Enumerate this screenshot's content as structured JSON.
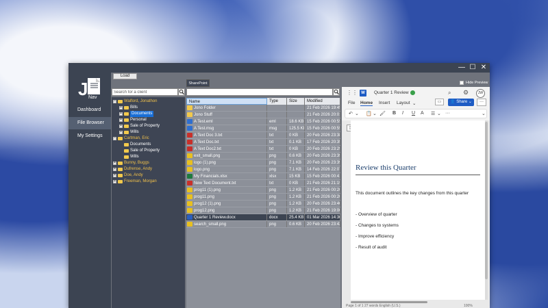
{
  "app": {
    "logo_letters": "JNav",
    "window_controls": [
      "—",
      "☐",
      "✕"
    ],
    "nav": [
      {
        "label": "Dashboard",
        "active": false
      },
      {
        "label": "File Browser",
        "active": true
      },
      {
        "label": "My Settings",
        "active": false
      }
    ],
    "load_label": "Load",
    "sharepoint_tab": "SharePoint",
    "hide_preview_label": "Hide Preview"
  },
  "clients": {
    "search_placeholder": "Search for a client",
    "tree": [
      {
        "label": "Walford, Jonathon",
        "level": 0,
        "exp": "−"
      },
      {
        "label": "Bills",
        "level": 1,
        "exp": "+"
      },
      {
        "label": "Documents",
        "level": 1,
        "exp": "+",
        "selected": true
      },
      {
        "label": "Personal",
        "level": 1,
        "exp": "+"
      },
      {
        "label": "Sale of Property",
        "level": 1,
        "exp": "+"
      },
      {
        "label": "Wills",
        "level": 1,
        "exp": "+"
      },
      {
        "label": "Cartman, Eric",
        "level": 0,
        "exp": "−"
      },
      {
        "label": "Documents",
        "level": 1,
        "exp": ""
      },
      {
        "label": "Sale of Property",
        "level": 1,
        "exp": ""
      },
      {
        "label": "Wills",
        "level": 1,
        "exp": ""
      },
      {
        "label": "Bunny, Buggs",
        "level": 0,
        "exp": "+"
      },
      {
        "label": "Dufrense, Andy",
        "level": 0,
        "exp": "+"
      },
      {
        "label": "Doe, Andy",
        "level": 0,
        "exp": "+"
      },
      {
        "label": "Freeman, Morgan",
        "level": 0,
        "exp": "+"
      }
    ]
  },
  "files": {
    "columns": [
      "Name",
      "Type",
      "Size",
      "Modified"
    ],
    "rows": [
      {
        "name": "Jono Folder",
        "type": "",
        "size": "",
        "modified": "21 Feb 2026 19:45",
        "icon": "folder"
      },
      {
        "name": "Jono Stuff",
        "type": "",
        "size": "",
        "modified": "21 Feb 2026 20:01",
        "icon": "folder"
      },
      {
        "name": "A Test.eml",
        "type": "eml",
        "size": "18.6 KB",
        "modified": "15 Feb 2026 00:55",
        "icon": "eml"
      },
      {
        "name": "A Test.msg",
        "type": "msg",
        "size": "125.5 KB",
        "modified": "15 Feb 2026 00:55",
        "icon": "eml"
      },
      {
        "name": "A Text Doc 3.txt",
        "type": "txt",
        "size": "0 KB",
        "modified": "20 Feb 2026 23:38",
        "icon": "txt"
      },
      {
        "name": "A Text Doc.txt",
        "type": "txt",
        "size": "0.1 KB",
        "modified": "17 Feb 2026 20:35",
        "icon": "txt"
      },
      {
        "name": "A Text Doc2.txt",
        "type": "txt",
        "size": "0 KB",
        "modified": "20 Feb 2026 23:29",
        "icon": "txt"
      },
      {
        "name": "exit_small.png",
        "type": "png",
        "size": "0.6 KB",
        "modified": "20 Feb 2026 23:39",
        "icon": "png"
      },
      {
        "name": "logo (1).png",
        "type": "png",
        "size": "7.1 KB",
        "modified": "20 Feb 2026 23:39",
        "icon": "png"
      },
      {
        "name": "logo.png",
        "type": "png",
        "size": "7.1 KB",
        "modified": "14 Feb 2026 22:07",
        "icon": "png"
      },
      {
        "name": "My Financials.xlsx",
        "type": "xlsx",
        "size": "15 KB",
        "modified": "15 Feb 2026 00:41",
        "icon": "xlsx"
      },
      {
        "name": "New Text Document.txt",
        "type": "txt",
        "size": "0 KB",
        "modified": "21 Feb 2026 21:19",
        "icon": "txt"
      },
      {
        "name": "prog11 (1).png",
        "type": "png",
        "size": "1.2 KB",
        "modified": "21 Feb 2026 00:20",
        "icon": "png"
      },
      {
        "name": "prog11.png",
        "type": "png",
        "size": "1.2 KB",
        "modified": "21 Feb 2026 00:20",
        "icon": "png"
      },
      {
        "name": "prog12 (1).png",
        "type": "png",
        "size": "1.2 KB",
        "modified": "20 Feb 2026 23:46",
        "icon": "png"
      },
      {
        "name": "prog12.png",
        "type": "png",
        "size": "1.2 KB",
        "modified": "21 Feb 2026 19:00",
        "icon": "png"
      },
      {
        "name": "Quarter 1 Review.docx",
        "type": "docx",
        "size": "25.4 KB",
        "modified": "01 Mar 2026 14:36",
        "icon": "docx",
        "selected": true
      },
      {
        "name": "search_small.png",
        "type": "png",
        "size": "0.6 KB",
        "modified": "20 Feb 2026 23:42",
        "icon": "png"
      }
    ]
  },
  "word": {
    "doc_name": "Quarter 1 Review",
    "avatar": "JW",
    "menu": [
      {
        "label": "File",
        "active": false
      },
      {
        "label": "Home",
        "active": true
      },
      {
        "label": "Insert",
        "active": false
      },
      {
        "label": "Layout",
        "active": false
      }
    ],
    "layout_chevron": "⌄",
    "share_label": "Share",
    "ribbon": [
      "↶",
      "⌄",
      "📋",
      "⌄",
      "🖌",
      "B",
      "I",
      "U",
      "A",
      "☰",
      "⌄",
      "···",
      "⌄"
    ],
    "doc": {
      "title": "Review this Quarter",
      "intro": "This document outlines the key changes from this quarter",
      "bullets": [
        "- Overview of quarter",
        "- Changes to systems",
        "- Improve efficiency",
        "- Result of audit"
      ]
    },
    "status": "Page 1 of 1   27 words   English (U.S.)",
    "zoom": "100%"
  },
  "colors": {
    "sidebar": "#3c4452",
    "accent": "#1e5cc4",
    "client_name": "#f0c04a"
  }
}
